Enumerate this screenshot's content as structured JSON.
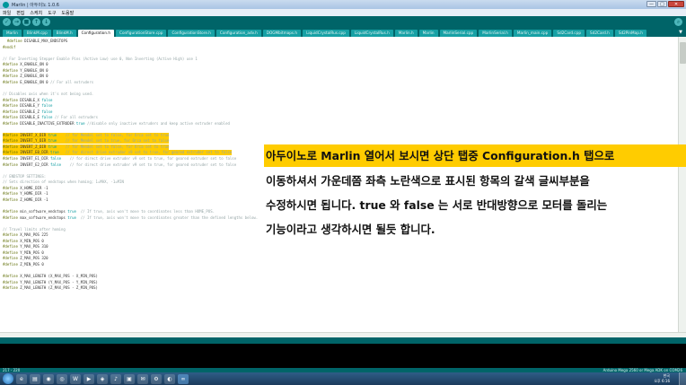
{
  "window": {
    "title": "Marlin | 아두이노 1.0.6",
    "buttons": {
      "minimize": "—",
      "maximize": "□",
      "close": "✕"
    }
  },
  "menu": [
    "파일",
    "편집",
    "스케치",
    "도구",
    "도움말"
  ],
  "toolbar": {
    "verify": "✓",
    "upload": "→",
    "new": "■",
    "open": "↑",
    "save": "↓",
    "serial": "⌕"
  },
  "tabs": [
    "Marlin",
    "BlinkM.cpp",
    "BlinkM.h",
    "Configuration.h",
    "ConfigurationStore.cpp",
    "ConfigurationStore.h",
    "Configuration_adv.h",
    "DOGMbitmaps.h",
    "LiquidCrystalRus.cpp",
    "LiquidCrystalRus.h",
    "Marlin.h",
    "Marlin",
    "MarlinSerial.cpp",
    "MarlinSerial.h",
    "Marlin_main.cpp",
    "Sd2Card.cpp",
    "Sd2Card.h",
    "Sd2PinMap.h"
  ],
  "active_tab": "Configuration.h",
  "code": [
    {
      "t": "  #define DISABLE_MAX_ENDSTOPS",
      "hl": false
    },
    {
      "t": "#endif",
      "hl": false
    },
    {
      "t": "",
      "hl": false
    },
    {
      "t": "// For Inverting Stepper Enable Pins (Active Low) use 0, Non Inverting (Active High) use 1",
      "hl": false
    },
    {
      "t": "#define X_ENABLE_ON 0",
      "hl": false
    },
    {
      "t": "#define Y_ENABLE_ON 0",
      "hl": false
    },
    {
      "t": "#define Z_ENABLE_ON 0",
      "hl": false
    },
    {
      "t": "#define E_ENABLE_ON 0 // For all extruders",
      "hl": false
    },
    {
      "t": "",
      "hl": false
    },
    {
      "t": "// Disables axis when it's not being used.",
      "hl": false
    },
    {
      "t": "#define DISABLE_X false",
      "hl": false
    },
    {
      "t": "#define DISABLE_Y false",
      "hl": false
    },
    {
      "t": "#define DISABLE_Z false",
      "hl": false
    },
    {
      "t": "#define DISABLE_E false // For all extruders",
      "hl": false
    },
    {
      "t": "#define DISABLE_INACTIVE_EXTRUDER true //disable only inactive extruders and keep active extruder enabled",
      "hl": false
    },
    {
      "t": "",
      "hl": false
    },
    {
      "t": "#define INVERT_X_DIR true    // for Mendel set to false, for Orca set to true",
      "hl": true
    },
    {
      "t": "#define INVERT_Y_DIR true    // for Mendel set to true, for Orca set to false",
      "hl": true
    },
    {
      "t": "#define INVERT_Z_DIR true    // for Mendel set to false, for Orca set to true",
      "hl": true
    },
    {
      "t": "#define INVERT_E0_DIR true   // for direct drive extruder v9 set to true, for geared extruder set to false",
      "hl": true
    },
    {
      "t": "#define INVERT_E1_DIR false    // for direct drive extruder v9 set to true, for geared extruder set to false",
      "hl": false
    },
    {
      "t": "#define INVERT_E2_DIR false    // for direct drive extruder v9 set to true, for geared extruder set to false",
      "hl": false
    },
    {
      "t": "",
      "hl": false
    },
    {
      "t": "// ENDSTOP SETTINGS:",
      "hl": false
    },
    {
      "t": "// Sets direction of endstops when homing; 1=MAX, -1=MIN",
      "hl": false
    },
    {
      "t": "#define X_HOME_DIR -1",
      "hl": false
    },
    {
      "t": "#define Y_HOME_DIR -1",
      "hl": false
    },
    {
      "t": "#define Z_HOME_DIR -1",
      "hl": false
    },
    {
      "t": "",
      "hl": false
    },
    {
      "t": "#define min_software_endstops true  // If true, axis won't move to coordinates less than HOME_POS.",
      "hl": false
    },
    {
      "t": "#define max_software_endstops true  // If true, axis won't move to coordinates greater than the defined lengths below.",
      "hl": false
    },
    {
      "t": "",
      "hl": false
    },
    {
      "t": "// Travel limits after homing",
      "hl": false
    },
    {
      "t": "#define X_MAX_POS 225",
      "hl": false
    },
    {
      "t": "#define X_MIN_POS 0",
      "hl": false
    },
    {
      "t": "#define Y_MAX_POS 310",
      "hl": false
    },
    {
      "t": "#define Y_MIN_POS 0",
      "hl": false
    },
    {
      "t": "#define Z_MAX_POS 320",
      "hl": false
    },
    {
      "t": "#define Z_MIN_POS 0",
      "hl": false
    },
    {
      "t": "",
      "hl": false
    },
    {
      "t": "#define X_MAX_LENGTH (X_MAX_POS - X_MIN_POS)",
      "hl": false
    },
    {
      "t": "#define Y_MAX_LENGTH (Y_MAX_POS - Y_MIN_POS)",
      "hl": false
    },
    {
      "t": "#define Z_MAX_LENGTH (Z_MAX_POS - Z_MIN_POS)",
      "hl": false
    }
  ],
  "annotation": [
    "아두이노로 Marlin 열어서 보시면 상단 탭중 Configuration.h 탭으로",
    "이동하셔서 가운데쯤 좌측 노란색으로 표시된 항목의 갈색 글씨부분을",
    "수정하시면 됩니다. true 와 false 는 서로 반대방향으로 모터를 돌리는",
    "기능이라고 생각하시면 될듯 합니다."
  ],
  "status": {
    "line": "217 - 220",
    "board": "Arduino Mega 2560 or Mega ADK on COM26"
  },
  "taskbar": {
    "icons": [
      "e",
      "▤",
      "◉",
      "◎",
      "W",
      "▶",
      "◈",
      "♪",
      "▣",
      "✉",
      "⚙",
      "◐",
      "∞"
    ],
    "lang": "한국",
    "time": "오후 6:16"
  },
  "colors": {
    "toolbar": "#006468",
    "tab": "#17a1a5",
    "highlight": "#ffcc00",
    "keyword": "#5e6d03",
    "literal": "#00979c"
  }
}
